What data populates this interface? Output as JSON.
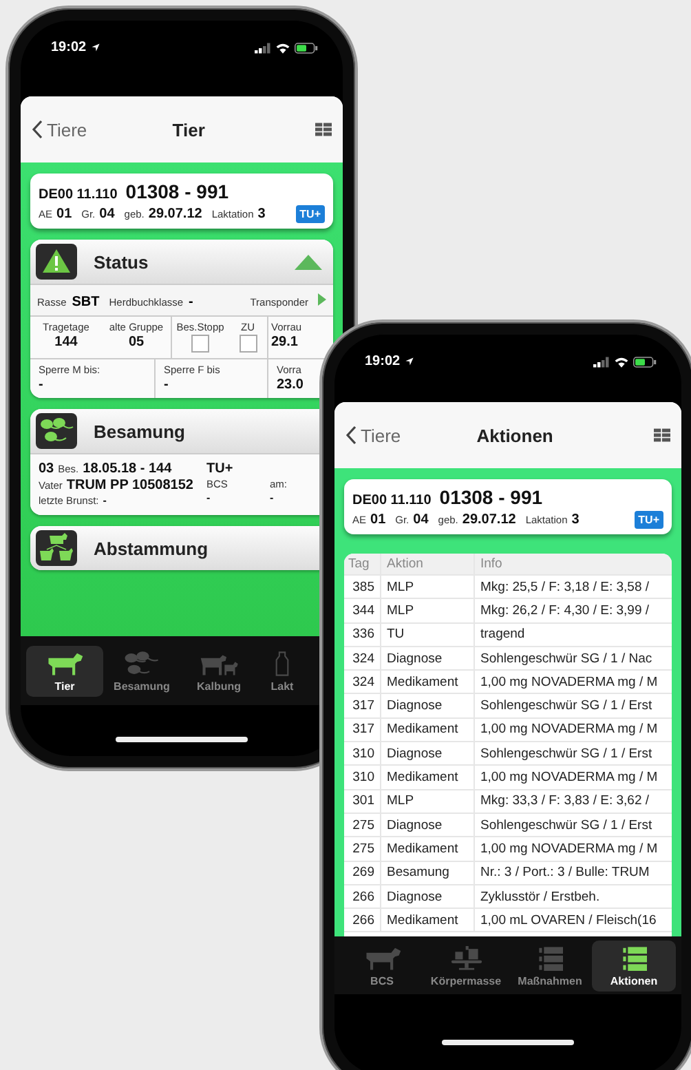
{
  "left_phone": {
    "status_bar": {
      "time": "19:02"
    },
    "nav": {
      "back": "Tiere",
      "title": "Tier"
    },
    "animal_card": {
      "id_prefix": "DE00 11.110",
      "number": "01308 - 991",
      "fields": [
        {
          "label": "AE",
          "value": "01"
        },
        {
          "label": "Gr.",
          "value": "04"
        },
        {
          "label": "geb.",
          "value": "29.07.12"
        },
        {
          "label": "Laktation",
          "value": "3"
        }
      ],
      "badge": "TU+"
    },
    "status_section": {
      "title": "Status",
      "expanded": true,
      "info": [
        {
          "label": "Rasse",
          "value": "SBT"
        },
        {
          "label": "Herdbuchklasse",
          "value": "-"
        }
      ],
      "transponder": "Transponder",
      "row_1": [
        {
          "kind": "value",
          "label": "Tragetage",
          "value": "144"
        },
        {
          "kind": "value",
          "label": "alte Gruppe",
          "value": "05"
        },
        {
          "kind": "checkbox",
          "label": "Bes.Stopp",
          "checked": false
        },
        {
          "kind": "checkbox",
          "label": "ZU",
          "checked": false
        },
        {
          "kind": "value",
          "label": "Vorrau",
          "value": "29.1"
        }
      ],
      "row_2": [
        {
          "label": "Sperre M bis:",
          "value": "-"
        },
        {
          "label": "Sperre F bis",
          "value": "-"
        },
        {
          "label": "Vorra",
          "value": "23.0"
        }
      ]
    },
    "besamung_section": {
      "title": "Besamung",
      "number": "03",
      "bes_label": "Bes.",
      "bes_value": "18.05.18 - 144",
      "tag": "TU+",
      "vater_label": "Vater",
      "vater_value": "TRUM PP 10508152",
      "bcs_label": "BCS",
      "am_label": "am:",
      "brunst_label": "letzte Brunst:",
      "brunst_value": "-",
      "bcs_value": "-",
      "am_value": "-"
    },
    "abstammung_section": {
      "title": "Abstammung"
    },
    "tabs": [
      {
        "label": "Tier",
        "selected": true
      },
      {
        "label": "Besamung",
        "selected": false
      },
      {
        "label": "Kalbung",
        "selected": false
      },
      {
        "label": "Lakt",
        "selected": false
      }
    ]
  },
  "right_phone": {
    "status_bar": {
      "time": "19:02"
    },
    "nav": {
      "back": "Tiere",
      "title": "Aktionen"
    },
    "animal_card": {
      "id_prefix": "DE00 11.110",
      "number": "01308 - 991",
      "fields": [
        {
          "label": "AE",
          "value": "01"
        },
        {
          "label": "Gr.",
          "value": "04"
        },
        {
          "label": "geb.",
          "value": "29.07.12"
        },
        {
          "label": "Laktation",
          "value": "3"
        }
      ],
      "badge": "TU+"
    },
    "table": {
      "columns": [
        "Tag",
        "Aktion",
        "Info"
      ],
      "rows": [
        [
          "385",
          "MLP",
          "Mkg: 25,5 / F: 3,18 / E: 3,58 /"
        ],
        [
          "344",
          "MLP",
          "Mkg: 26,2 / F: 4,30 / E: 3,99 /"
        ],
        [
          "336",
          "TU",
          "tragend"
        ],
        [
          "324",
          "Diagnose",
          "Sohlengeschwür SG / 1 / Nac"
        ],
        [
          "324",
          "Medikament",
          "1,00 mg NOVADERMA mg / M"
        ],
        [
          "317",
          "Diagnose",
          "Sohlengeschwür SG / 1 / Erst"
        ],
        [
          "317",
          "Medikament",
          "1,00 mg NOVADERMA mg / M"
        ],
        [
          "310",
          "Diagnose",
          "Sohlengeschwür SG / 1 / Erst"
        ],
        [
          "310",
          "Medikament",
          "1,00 mg NOVADERMA mg / M"
        ],
        [
          "301",
          "MLP",
          "Mkg: 33,3 / F: 3,83 / E: 3,62 /"
        ],
        [
          "275",
          "Diagnose",
          "Sohlengeschwür SG / 1 / Erst"
        ],
        [
          "275",
          "Medikament",
          "1,00 mg NOVADERMA mg / M"
        ],
        [
          "269",
          "Besamung",
          "Nr.: 3 / Port.: 3 / Bulle: TRUM"
        ],
        [
          "266",
          "Diagnose",
          "Zyklusstör / Erstbeh."
        ],
        [
          "266",
          "Medikament",
          "1,00 mL OVAREN / Fleisch(16"
        ]
      ]
    },
    "tabs": [
      {
        "label": "BCS",
        "selected": false
      },
      {
        "label": "Körpermasse",
        "selected": false
      },
      {
        "label": "Maßnahmen",
        "selected": false
      },
      {
        "label": "Aktionen",
        "selected": true
      }
    ]
  }
}
